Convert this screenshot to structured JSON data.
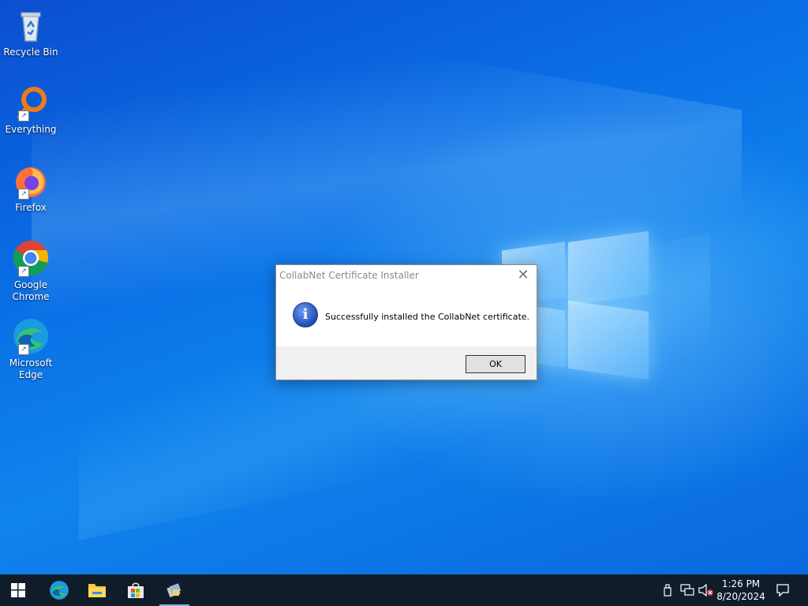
{
  "desktop": {
    "icons": [
      {
        "name": "recycle-bin",
        "label": "Recycle Bin",
        "icon": "recycle-bin-icon"
      },
      {
        "name": "everything",
        "label": "Everything",
        "icon": "magnifier-icon"
      },
      {
        "name": "firefox",
        "label": "Firefox",
        "icon": "firefox-icon"
      },
      {
        "name": "google-chrome",
        "label": "Google\nChrome",
        "icon": "chrome-icon"
      },
      {
        "name": "microsoft-edge",
        "label": "Microsoft\nEdge",
        "icon": "edge-icon"
      }
    ]
  },
  "dialog": {
    "title": "CollabNet Certificate Installer",
    "message": "Successfully installed the CollabNet certificate.",
    "ok_label": "OK",
    "close_glyph": "✕",
    "info_glyph": "i"
  },
  "taskbar": {
    "start_icon": "windows-start-icon",
    "pinned": [
      "edge-icon",
      "file-explorer-icon",
      "store-icon",
      "installer-app-icon"
    ],
    "tray": [
      "usb-icon",
      "network-icon",
      "volume-muted-icon"
    ],
    "time": "1:26 PM",
    "date": "8/20/2024",
    "notification_icon": "action-center-icon"
  },
  "colors": {
    "accent": "#0a63d8",
    "taskbar": "#101c2a",
    "dialog_footer": "#f0f0f0"
  }
}
